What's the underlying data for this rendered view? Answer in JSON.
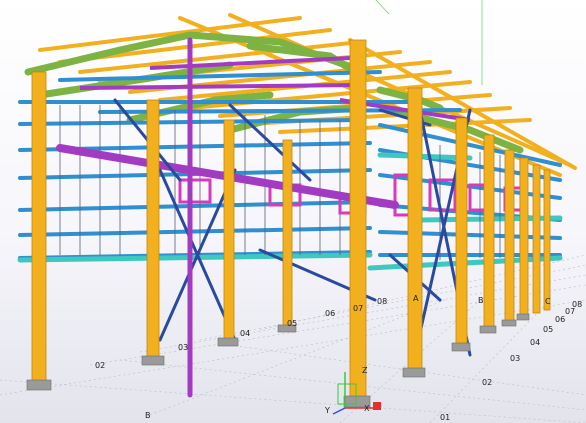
{
  "viewport": {
    "name": "3D model view",
    "grid_labels_numbers_front": [
      "01",
      "02",
      "03",
      "04",
      "05",
      "06",
      "07"
    ],
    "grid_labels_numbers_right": [
      "01",
      "02",
      "03",
      "04",
      "05",
      "06",
      "07",
      "08"
    ],
    "grid_labels_letters": [
      "A",
      "B",
      "C",
      "B"
    ],
    "axis_labels": {
      "x": "X",
      "y": "Y",
      "z": "Z"
    },
    "colors": {
      "column": "#f2b01e",
      "girt": "#2f8fd0",
      "rafter": "#7cb342",
      "bracing": "#7b2fa8",
      "purple_member": "#a23bc2",
      "magenta_member": "#d63bb8",
      "cyan_member": "#3ec8c0",
      "cable": "#5a6070",
      "base_plate": "#9a9a9a"
    }
  }
}
